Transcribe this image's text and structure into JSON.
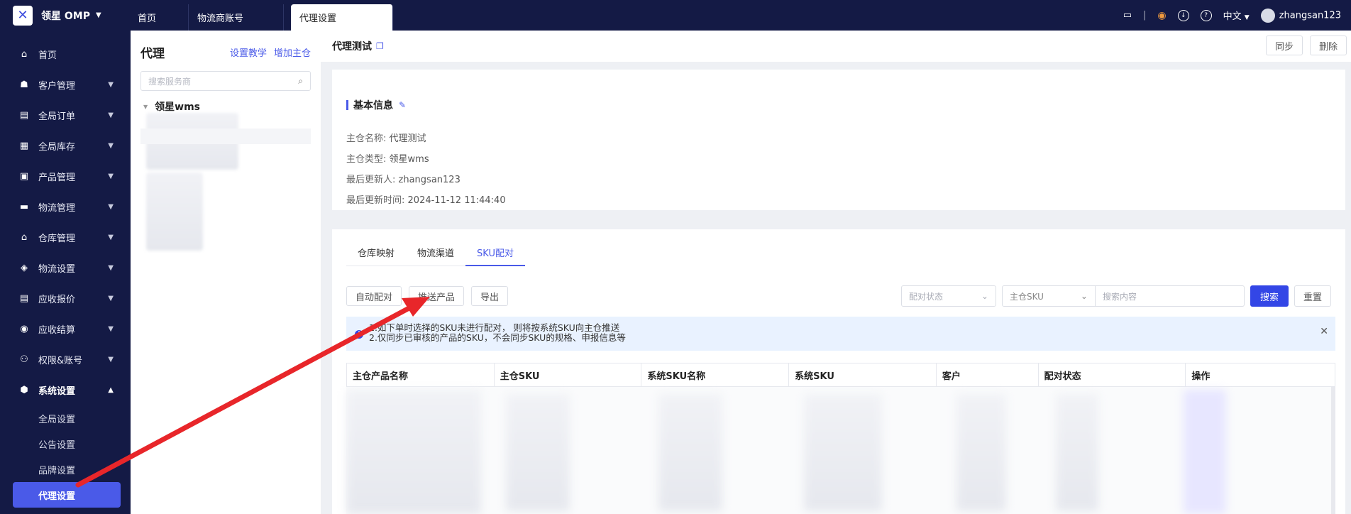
{
  "topbar": {
    "brand": "领星 OMP",
    "tabs": [
      {
        "label": "首页"
      },
      {
        "label": "物流商账号"
      },
      {
        "label": "代理设置"
      }
    ],
    "language": "中文",
    "username": "zhangsan123"
  },
  "sidebar": {
    "items": [
      {
        "label": "首页",
        "icon": "home-icon"
      },
      {
        "label": "客户管理",
        "icon": "customer-icon"
      },
      {
        "label": "全局订单",
        "icon": "order-icon"
      },
      {
        "label": "全局库存",
        "icon": "inventory-icon"
      },
      {
        "label": "产品管理",
        "icon": "product-icon"
      },
      {
        "label": "物流管理",
        "icon": "truck-icon"
      },
      {
        "label": "仓库管理",
        "icon": "warehouse-icon"
      },
      {
        "label": "物流设置",
        "icon": "box-icon"
      },
      {
        "label": "应收报价",
        "icon": "quote-icon"
      },
      {
        "label": "应收结算",
        "icon": "settlement-icon"
      },
      {
        "label": "权限&账号",
        "icon": "org-icon"
      },
      {
        "label": "系统设置",
        "icon": "settings-icon"
      }
    ],
    "subitems": [
      {
        "label": "全局设置"
      },
      {
        "label": "公告设置"
      },
      {
        "label": "品牌设置"
      },
      {
        "label": "代理设置"
      }
    ]
  },
  "tree": {
    "title": "代理",
    "link_tutorial": "设置教学",
    "link_add": "增加主仓",
    "search_placeholder": "搜索服务商",
    "root_node": "领星wms"
  },
  "main": {
    "title": "代理测试",
    "sync_label": "同步",
    "delete_label": "删除",
    "basic": {
      "title": "基本信息",
      "rows": [
        {
          "label": "主仓名称:",
          "value": "代理测试"
        },
        {
          "label": "主仓类型:",
          "value": "领星wms"
        },
        {
          "label": "最后更新人:",
          "value": "zhangsan123"
        },
        {
          "label": "最后更新时间:",
          "value": "2024-11-12 11:44:40"
        }
      ]
    },
    "subtabs": [
      {
        "label": "仓库映射"
      },
      {
        "label": "物流渠道"
      },
      {
        "label": "SKU配对"
      }
    ],
    "actions": {
      "auto_match": "自动配对",
      "push_product": "推送产品",
      "export": "导出"
    },
    "filters": {
      "match_status": "配对状态",
      "main_sku": "主仓SKU",
      "search_placeholder": "搜索内容",
      "search": "搜索",
      "reset": "重置"
    },
    "notice": {
      "line1": "1.如下单时选择的SKU未进行配对， 则将按系统SKU向主仓推送",
      "line2": "2.仅同步已审核的产品的SKU，不会同步SKU的规格、申报信息等"
    },
    "table": {
      "columns": [
        "主仓产品名称",
        "主仓SKU",
        "系统SKU名称",
        "系统SKU",
        "客户",
        "配对状态",
        "操作"
      ]
    }
  },
  "colors": {
    "nav_bg": "#141a45",
    "accent": "#4a5ae8",
    "arrow": "#e8262a"
  }
}
